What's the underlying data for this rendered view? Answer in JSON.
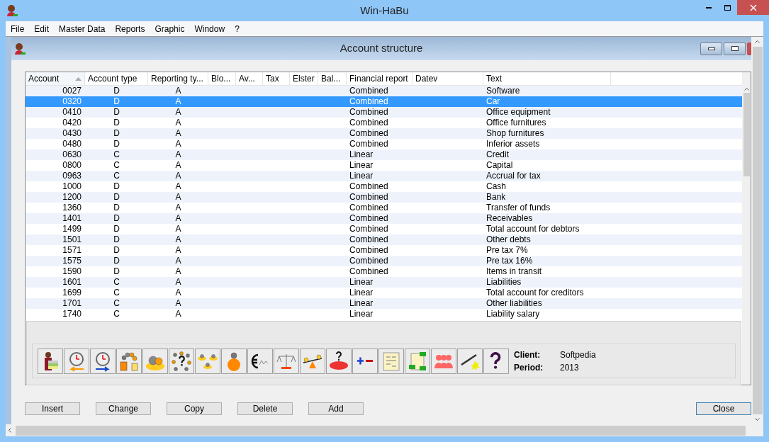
{
  "window": {
    "title": "Win-HaBu"
  },
  "menu": [
    "File",
    "Edit",
    "Master Data",
    "Reports",
    "Graphic",
    "Window",
    "?"
  ],
  "child_window": {
    "title": "Account structure"
  },
  "table": {
    "columns": [
      {
        "label": "Account",
        "sorted": true
      },
      {
        "label": "Account type",
        "sorted": false
      },
      {
        "label": "Reporting ty...",
        "sorted": false
      },
      {
        "label": "Blo...",
        "sorted": false
      },
      {
        "label": "Av...",
        "sorted": false
      },
      {
        "label": "Tax",
        "sorted": false
      },
      {
        "label": "Elster",
        "sorted": false
      },
      {
        "label": "Bal...",
        "sorted": false
      },
      {
        "label": "Financial report",
        "sorted": false
      },
      {
        "label": "Datev",
        "sorted": false
      },
      {
        "label": "Text",
        "sorted": false
      }
    ],
    "rows": [
      {
        "account": "0027",
        "type": "D",
        "reporting": "A",
        "financial": "Combined",
        "text": "Software",
        "selected": false
      },
      {
        "account": "0320",
        "type": "D",
        "reporting": "A",
        "financial": "Combined",
        "text": "Car",
        "selected": true
      },
      {
        "account": "0410",
        "type": "D",
        "reporting": "A",
        "financial": "Combined",
        "text": "Office equipment",
        "selected": false
      },
      {
        "account": "0420",
        "type": "D",
        "reporting": "A",
        "financial": "Combined",
        "text": "Office furnitures",
        "selected": false
      },
      {
        "account": "0430",
        "type": "D",
        "reporting": "A",
        "financial": "Combined",
        "text": "Shop furnitures",
        "selected": false
      },
      {
        "account": "0480",
        "type": "D",
        "reporting": "A",
        "financial": "Combined",
        "text": "Inferior assets",
        "selected": false
      },
      {
        "account": "0630",
        "type": "C",
        "reporting": "A",
        "financial": "Linear",
        "text": "Credit",
        "selected": false
      },
      {
        "account": "0800",
        "type": "C",
        "reporting": "A",
        "financial": "Linear",
        "text": "Capital",
        "selected": false
      },
      {
        "account": "0963",
        "type": "C",
        "reporting": "A",
        "financial": "Linear",
        "text": "Accrual for tax",
        "selected": false
      },
      {
        "account": "1000",
        "type": "D",
        "reporting": "A",
        "financial": "Combined",
        "text": "Cash",
        "selected": false
      },
      {
        "account": "1200",
        "type": "D",
        "reporting": "A",
        "financial": "Combined",
        "text": "Bank",
        "selected": false
      },
      {
        "account": "1360",
        "type": "D",
        "reporting": "A",
        "financial": "Combined",
        "text": "Transfer of funds",
        "selected": false
      },
      {
        "account": "1401",
        "type": "D",
        "reporting": "A",
        "financial": "Combined",
        "text": "Receivables",
        "selected": false
      },
      {
        "account": "1499",
        "type": "D",
        "reporting": "A",
        "financial": "Combined",
        "text": "Total account for debtors",
        "selected": false
      },
      {
        "account": "1501",
        "type": "D",
        "reporting": "A",
        "financial": "Combined",
        "text": "Other debts",
        "selected": false
      },
      {
        "account": "1571",
        "type": "D",
        "reporting": "A",
        "financial": "Combined",
        "text": "Pre tax 7%",
        "selected": false
      },
      {
        "account": "1575",
        "type": "D",
        "reporting": "A",
        "financial": "Combined",
        "text": "Pre tax 16%",
        "selected": false
      },
      {
        "account": "1590",
        "type": "D",
        "reporting": "A",
        "financial": "Combined",
        "text": "Items in transit",
        "selected": false
      },
      {
        "account": "1601",
        "type": "C",
        "reporting": "A",
        "financial": "Linear",
        "text": "Liabilities",
        "selected": false
      },
      {
        "account": "1699",
        "type": "C",
        "reporting": "A",
        "financial": "Linear",
        "text": "Total account for creditors",
        "selected": false
      },
      {
        "account": "1701",
        "type": "C",
        "reporting": "A",
        "financial": "Linear",
        "text": "Other liabilities",
        "selected": false
      },
      {
        "account": "1740",
        "type": "C",
        "reporting": "A",
        "financial": "Linear",
        "text": "Liability salary",
        "selected": false
      }
    ]
  },
  "info": [
    {
      "label": "Client:",
      "value": "Softpedia"
    },
    {
      "label": "Period:",
      "value": "2013"
    }
  ],
  "buttons": [
    {
      "label": "Insert",
      "focused": false
    },
    {
      "label": "Change",
      "focused": false
    },
    {
      "label": "Copy",
      "focused": false
    },
    {
      "label": "Delete",
      "focused": false
    },
    {
      "label": "Add",
      "focused": false
    },
    {
      "label": "Close",
      "focused": true
    }
  ]
}
